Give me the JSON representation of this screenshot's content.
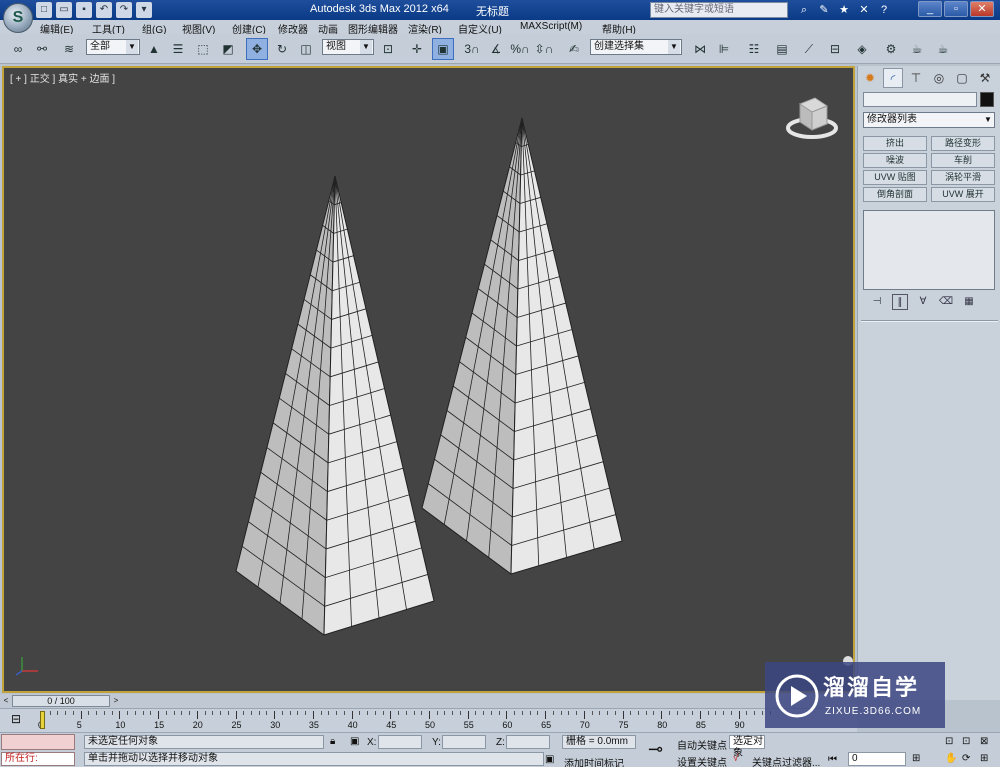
{
  "window": {
    "title": "Autodesk 3ds Max  2012 x64",
    "doc_title": "无标题",
    "search_placeholder": "键入关键字或短语"
  },
  "menu": [
    "编辑(E)",
    "工具(T)",
    "组(G)",
    "视图(V)",
    "创建(C)",
    "修改器",
    "动画",
    "图形编辑器",
    "渲染(R)",
    "自定义(U)",
    "MAXScript(M)",
    "帮助(H)"
  ],
  "toolbar": {
    "filter_value": "全部",
    "refcoord_value": "视图",
    "selset_value": "创建选择集"
  },
  "viewport": {
    "label": "[ + ] 正交  ] 真实 + 边面 ]"
  },
  "command_panel": {
    "modifier_list": "修改器列表",
    "modifier_buttons": [
      "挤出",
      "路径变形",
      "噪波",
      "车削",
      "UVW 贴图",
      "涡轮平滑",
      "倒角剖面",
      "UVW 展开"
    ]
  },
  "timeline": {
    "frame_display": "0 / 100",
    "ticks": [
      "0",
      "5",
      "10",
      "15",
      "20",
      "25",
      "30",
      "35",
      "40",
      "45",
      "50",
      "55",
      "60",
      "65",
      "70",
      "75",
      "80",
      "85",
      "90"
    ]
  },
  "status": {
    "running_label": "所在行:",
    "selection_msg": "未选定任何对象",
    "prompt_msg": "单击并拖动以选择并移动对象",
    "x_label": "X:",
    "y_label": "Y:",
    "z_label": "Z:",
    "grid_text": "栅格 = 0.0mm",
    "add_time_tag": "添加时间标记",
    "auto_key": "自动关键点",
    "set_key": "设置关键点",
    "selected_obj": "选定对象",
    "key_filters": "关键点过滤器...",
    "frame_value": "0"
  },
  "watermark": {
    "line1": "溜溜自学",
    "line2": "ZIXUE.3D66.COM"
  }
}
